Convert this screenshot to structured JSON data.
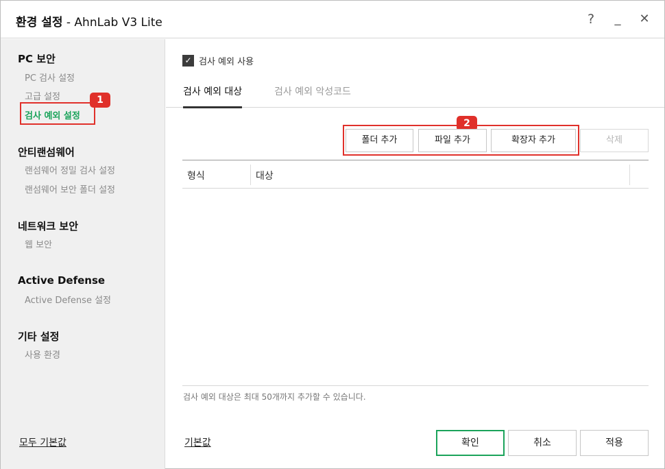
{
  "window": {
    "title_bold": "환경 설정",
    "title_rest": " - AhnLab V3 Lite",
    "help": "?",
    "minimize": "_",
    "close": "✕"
  },
  "sidebar": {
    "sections": [
      {
        "title": "PC 보안",
        "items": [
          "PC 검사 설정",
          "고급 설정",
          "검사 예외 설정"
        ]
      },
      {
        "title": "안티랜섬웨어",
        "items": [
          "랜섬웨어 정밀 검사 설정",
          "랜섬웨어 보안 폴더 설정"
        ]
      },
      {
        "title": "네트워크 보안",
        "items": [
          "웹 보안"
        ]
      },
      {
        "title": "Active Defense",
        "items": [
          "Active Defense 설정"
        ]
      },
      {
        "title": "기타 설정",
        "items": [
          "사용 환경"
        ]
      }
    ],
    "reset_all": "모두 기본값"
  },
  "badges": {
    "one": "1",
    "two": "2"
  },
  "main": {
    "enable_checkbox": {
      "label": "검사 예외 사용",
      "checked": true,
      "mark": "✓"
    },
    "tabs": [
      "검사 예외 대상",
      "검사 예외 악성코드"
    ],
    "buttons": {
      "add_folder": "폴더 추가",
      "add_file": "파일 추가",
      "add_extension": "확장자 추가",
      "delete": "삭제"
    },
    "table": {
      "columns": [
        "형식",
        "대상"
      ],
      "rows": []
    },
    "note": "검사 예외 대상은 최대 50개까지 추가할 수 있습니다.",
    "reset": "기본값",
    "footer": {
      "ok": "확인",
      "cancel": "취소",
      "apply": "적용"
    }
  },
  "colors": {
    "accent": "#1aa35a",
    "highlight": "#e0302a",
    "sidebar_bg": "#f0f0f0"
  }
}
